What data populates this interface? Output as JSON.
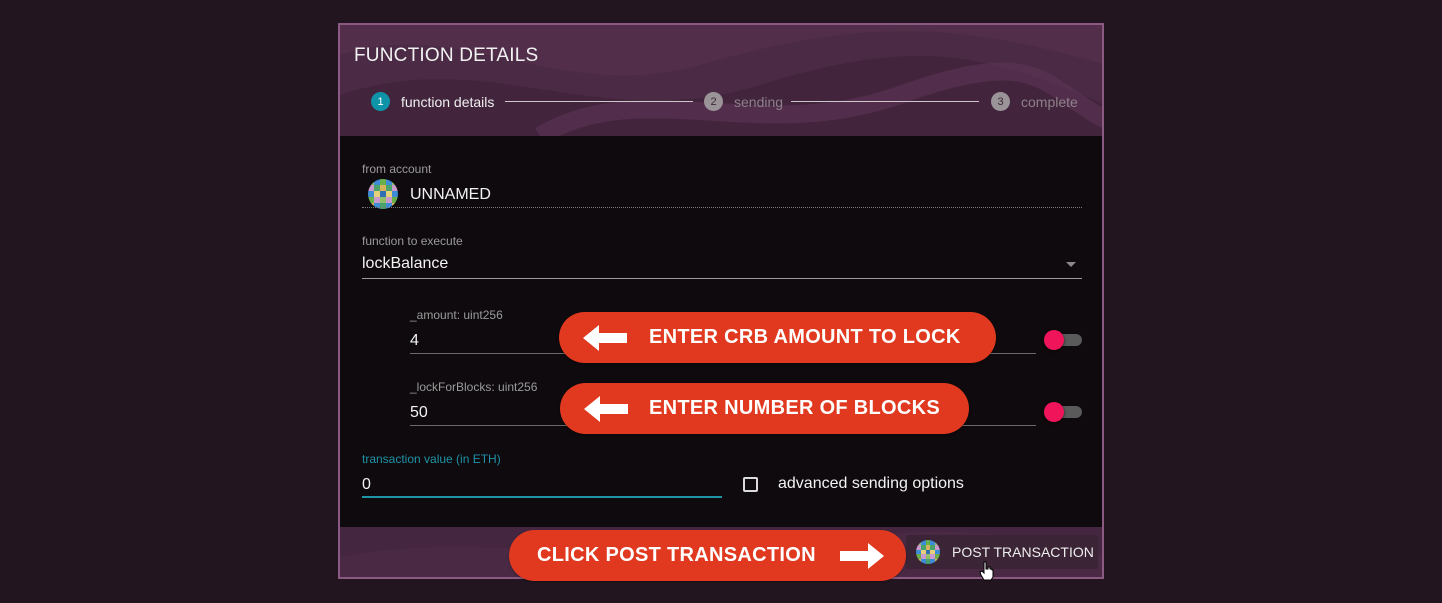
{
  "dialog": {
    "title": "FUNCTION DETAILS",
    "steps": [
      {
        "num": "1",
        "label": "function details"
      },
      {
        "num": "2",
        "label": "sending"
      },
      {
        "num": "3",
        "label": "complete"
      }
    ]
  },
  "form": {
    "from_account": {
      "label": "from account",
      "value": "UNNAMED"
    },
    "function": {
      "label": "function to execute",
      "value": "lockBalance"
    },
    "amount": {
      "label": "_amount: uint256",
      "value": "4"
    },
    "lock_blocks": {
      "label": "_lockForBlocks: uint256",
      "value": "50"
    },
    "tx_value": {
      "label": "transaction value (in ETH)",
      "value": "0"
    },
    "advanced": {
      "label": "advanced sending options"
    }
  },
  "footer": {
    "post_label": "POST TRANSACTION"
  },
  "annotations": {
    "amount_hint": "ENTER CRB AMOUNT TO LOCK",
    "blocks_hint": "ENTER NUMBER OF BLOCKS",
    "post_hint": "CLICK POST TRANSACTION"
  },
  "colors": {
    "accent": "#0f93a8",
    "toggle_knob": "#f0145a",
    "annotation": "#e0391f",
    "header": "#4a2a44",
    "background": "#221520"
  },
  "icons": [
    "identicon",
    "chevron-down-icon",
    "arrow-left-icon",
    "arrow-right-icon",
    "hand-cursor-icon"
  ]
}
